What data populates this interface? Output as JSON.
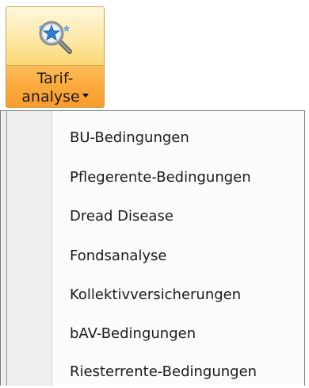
{
  "ribbon_button": {
    "label_line1": "Tarif-",
    "label_line2": "analyse",
    "icon": "magnifier-star-icon",
    "accent_colors": [
      "#fcd774",
      "#f99a2c"
    ]
  },
  "menu": {
    "items": [
      {
        "label": "BU-Bedingungen"
      },
      {
        "label": "Pflegerente-Bedingungen"
      },
      {
        "label": "Dread Disease"
      },
      {
        "label": "Fondsanalyse"
      },
      {
        "label": "Kollektivversicherungen"
      },
      {
        "label": "bAV-Bedingungen"
      },
      {
        "label": "Riesterrente-Bedingungen"
      }
    ]
  }
}
